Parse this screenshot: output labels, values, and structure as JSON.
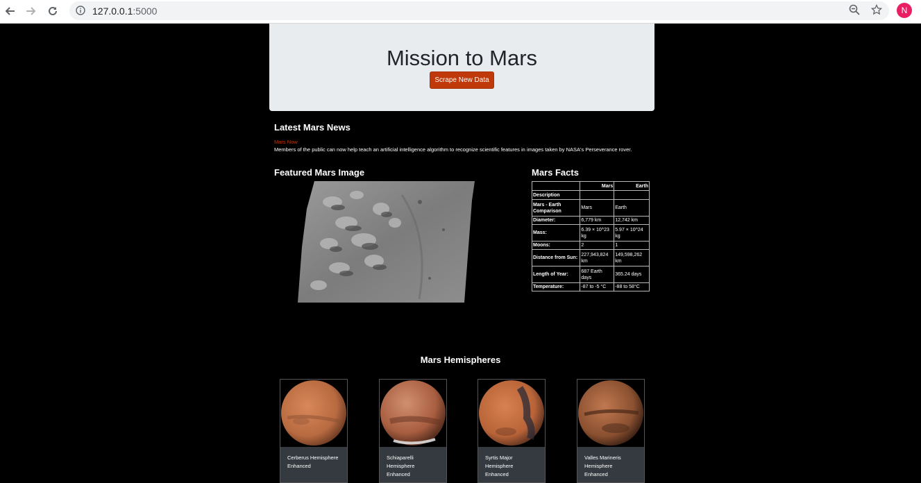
{
  "browser": {
    "url_host": "127.0.0.1",
    "url_port": ":5000",
    "profile_initial": "N",
    "icons": [
      "back-arrow-icon",
      "forward-arrow-icon",
      "reload-icon",
      "info-icon",
      "zoom-out-icon",
      "star-icon"
    ]
  },
  "header": {
    "title": "Mission to Mars",
    "scrape_button": "Scrape New Data",
    "button_color": "#c0390b"
  },
  "news": {
    "heading": "Latest Mars News",
    "title": "Mars Now",
    "paragraph": "Members of the public can now help teach an artificial intelligence algorithm to recognize scientific features in images taken by NASA's Perseverance rover."
  },
  "featured": {
    "heading": "Featured Mars Image"
  },
  "facts": {
    "heading": "Mars Facts",
    "columns": [
      "",
      "Mars",
      "Earth"
    ],
    "index_label": "Description",
    "rows": [
      {
        "label": "Mars - Earth Comparison",
        "mars": "Mars",
        "earth": "Earth"
      },
      {
        "label": "Diameter:",
        "mars": "6,779 km",
        "earth": "12,742 km"
      },
      {
        "label": "Mass:",
        "mars": "6.39 × 10^23 kg",
        "earth": "5.97 × 10^24 kg"
      },
      {
        "label": "Moons:",
        "mars": "2",
        "earth": "1"
      },
      {
        "label": "Distance from Sun:",
        "mars": "227,943,824 km",
        "earth": "149,598,262 km"
      },
      {
        "label": "Length of Year:",
        "mars": "687 Earth days",
        "earth": "365.24 days"
      },
      {
        "label": "Temperature:",
        "mars": "-87 to -5 °C",
        "earth": "-88 to 58°C"
      }
    ]
  },
  "hemispheres": {
    "heading": "Mars Hemispheres",
    "items": [
      {
        "title": "Cerberus Hemisphere Enhanced"
      },
      {
        "title": "Schiaparelli Hemisphere Enhanced"
      },
      {
        "title": "Syrtis Major Hemisphere Enhanced"
      },
      {
        "title": "Valles Marineris Hemisphere Enhanced"
      }
    ]
  }
}
